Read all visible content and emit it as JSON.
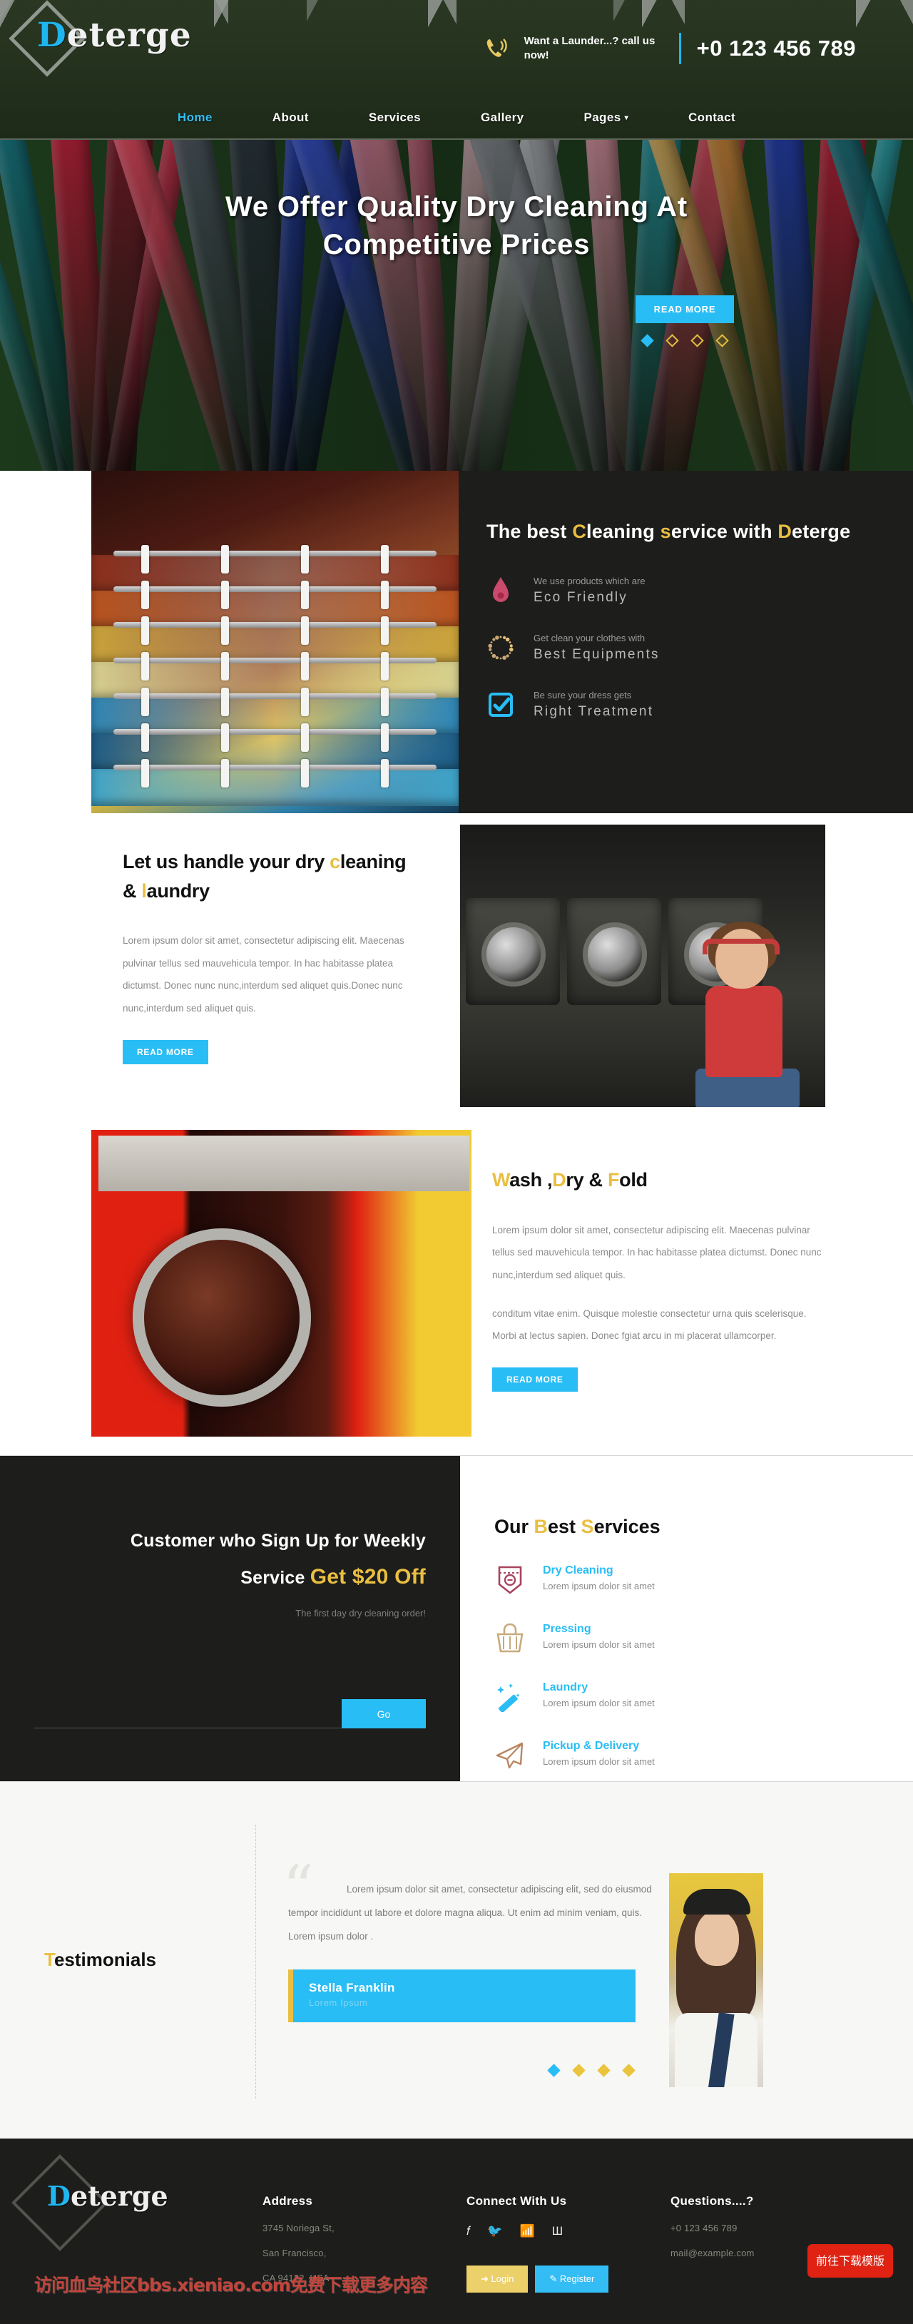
{
  "brand": {
    "name_first": "D",
    "name_rest": "eterge"
  },
  "header": {
    "phone_icon": "phone-ringing-icon",
    "message": "Want a Launder...? call us now!",
    "phone": "+0 123 456 789"
  },
  "nav": {
    "items": [
      {
        "label": "Home",
        "active": true
      },
      {
        "label": "About",
        "active": false
      },
      {
        "label": "Services",
        "active": false
      },
      {
        "label": "Gallery",
        "active": false
      },
      {
        "label": "Pages",
        "active": false,
        "caret": "▾"
      },
      {
        "label": "Contact",
        "active": false
      }
    ]
  },
  "hero": {
    "title": "We Offer Quality Dry Cleaning At Competitive Prices",
    "button": "READ MORE",
    "dots": [
      "active",
      "outline",
      "outline",
      "outline"
    ]
  },
  "about": {
    "heading_parts": [
      {
        "t": "The best ",
        "hl": false
      },
      {
        "t": "C",
        "hl": true
      },
      {
        "t": "leaning ",
        "hl": false
      },
      {
        "t": "s",
        "hl": true
      },
      {
        "t": "ervice with ",
        "hl": false
      },
      {
        "t": "D",
        "hl": true
      },
      {
        "t": "eterge",
        "hl": false
      }
    ],
    "features": [
      {
        "icon": "water-drop-icon",
        "small": "We use products which are",
        "big": "Eco Friendly"
      },
      {
        "icon": "dotted-circle-icon",
        "small": "Get clean your clothes with",
        "big": "Best Equipments"
      },
      {
        "icon": "checkbox-checked-icon",
        "small": "Be sure your dress gets",
        "big": "Right Treatment"
      }
    ]
  },
  "handle": {
    "heading_parts": [
      {
        "t": "Let us handle your dry ",
        "hl": false
      },
      {
        "t": "c",
        "hl": true
      },
      {
        "t": "leaning & ",
        "hl": false
      },
      {
        "t": "l",
        "hl": true
      },
      {
        "t": "aundry",
        "hl": false
      }
    ],
    "paragraph": "Lorem ipsum dolor sit amet, consectetur adipiscing elit. Maecenas pulvinar tellus sed mauvehicula tempor. In hac habitasse platea dictumst. Donec nunc nunc,interdum sed aliquet quis.Donec nunc nunc,interdum sed aliquet quis.",
    "button": "READ MORE"
  },
  "wash": {
    "heading_parts": [
      {
        "t": "W",
        "hl": true
      },
      {
        "t": "ash ,",
        "hl": false
      },
      {
        "t": "D",
        "hl": true
      },
      {
        "t": "ry & ",
        "hl": false
      },
      {
        "t": "F",
        "hl": true
      },
      {
        "t": "old",
        "hl": false
      }
    ],
    "paragraph1": "Lorem ipsum dolor sit amet, consectetur adipiscing elit. Maecenas pulvinar tellus sed mauvehicula tempor. In hac habitasse platea dictumst. Donec nunc nunc,interdum sed aliquet quis.",
    "paragraph2": "conditum vitae enim. Quisque molestie consectetur urna quis scelerisque. Morbi at lectus sapien. Donec fgiat arcu in mi placerat ullamcorper.",
    "button": "READ MORE"
  },
  "promo": {
    "line1": "Customer who Sign Up for Weekly",
    "line2_plain": "Service ",
    "line2_money": "Get $20 Off",
    "sub": "The first day dry cleaning order!",
    "input_placeholder": "",
    "input_value": "",
    "go": "Go"
  },
  "services": {
    "heading_parts": [
      {
        "t": "Our ",
        "hl": false
      },
      {
        "t": "B",
        "hl": true
      },
      {
        "t": "est ",
        "hl": false
      },
      {
        "t": "S",
        "hl": true
      },
      {
        "t": "ervices",
        "hl": false
      }
    ],
    "items": [
      {
        "icon": "pocket-badge-icon",
        "title": "Dry Cleaning",
        "desc": "Lorem ipsum dolor sit amet"
      },
      {
        "icon": "laundry-basket-icon",
        "title": "Pressing",
        "desc": "Lorem ipsum dolor sit amet"
      },
      {
        "icon": "magic-wand-icon",
        "title": "Laundry",
        "desc": "Lorem ipsum dolor sit amet"
      },
      {
        "icon": "paper-plane-icon",
        "title": "Pickup & Delivery",
        "desc": "Lorem ipsum dolor sit amet"
      }
    ]
  },
  "testimonials": {
    "heading_parts": [
      {
        "t": "T",
        "hl": true
      },
      {
        "t": "estimonials",
        "hl": false
      }
    ],
    "quote": "Lorem ipsum dolor sit amet, consectetur adipiscing elit, sed do eiusmod tempor incididunt ut labore et dolore magna aliqua. Ut enim ad minim veniam, quis. Lorem ipsum dolor .",
    "author": "Stella Franklin",
    "role": "Lorem Ipsum",
    "dots": [
      "active",
      "gold",
      "gold",
      "gold"
    ]
  },
  "footer": {
    "address": {
      "title": "Address",
      "lines": [
        "3745 Noriega St,",
        "San Francisco,",
        "CA 94122, USA"
      ]
    },
    "connect": {
      "title": "Connect With Us",
      "socials": [
        "facebook-icon",
        "twitter-icon",
        "rss-icon",
        "vk-icon"
      ],
      "login": "Login",
      "register": "Register"
    },
    "questions": {
      "title": "Questions....?",
      "phone": "+0 123 456 789",
      "email": "mail@example.com"
    },
    "download_button": "前往下载模版",
    "watermark": "访问血鸟社区bbs.xieniao.com免费下载更多内容"
  },
  "colors": {
    "accent_blue": "#29bdf5",
    "accent_gold": "#e9bf42",
    "dark": "#1d1d1b",
    "red": "#e02212"
  }
}
